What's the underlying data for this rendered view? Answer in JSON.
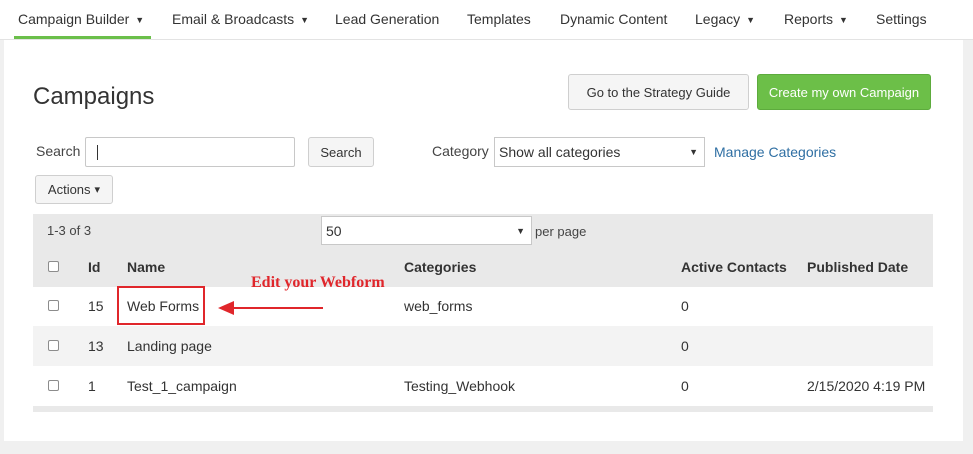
{
  "nav": {
    "items": [
      {
        "label": "Campaign Builder",
        "caret": true,
        "active": true
      },
      {
        "label": "Email & Broadcasts",
        "caret": true
      },
      {
        "label": "Lead Generation",
        "caret": false
      },
      {
        "label": "Templates",
        "caret": false
      },
      {
        "label": "Dynamic Content",
        "caret": false
      },
      {
        "label": "Legacy",
        "caret": true
      },
      {
        "label": "Reports",
        "caret": true
      },
      {
        "label": "Settings",
        "caret": false
      }
    ],
    "caret_glyph": "▼"
  },
  "page": {
    "title": "Campaigns",
    "strategy_button": "Go to the Strategy Guide",
    "create_button": "Create my own Campaign",
    "search_label": "Search",
    "search_value": "",
    "search_button": "Search",
    "category_label": "Category",
    "category_selected": "Show all categories",
    "manage_link": "Manage Categories",
    "actions_button": "Actions",
    "actions_caret": "▾",
    "select_arrow": "▼"
  },
  "pagination": {
    "range": "1-3 of 3",
    "per_page_value": "50",
    "per_page_label": "per page"
  },
  "table": {
    "headers": {
      "id": "Id",
      "name": "Name",
      "categories": "Categories",
      "active": "Active Contacts",
      "published": "Published Date"
    },
    "rows": [
      {
        "id": "15",
        "name": "Web Forms",
        "categories": "web_forms",
        "active": "0",
        "published": ""
      },
      {
        "id": "13",
        "name": "Landing page",
        "categories": "",
        "active": "0",
        "published": ""
      },
      {
        "id": "1",
        "name": "Test_1_campaign",
        "categories": "Testing_Webhook",
        "active": "0",
        "published": "2/15/2020 4:19 PM"
      }
    ]
  },
  "annotation": {
    "text": "Edit your Webform",
    "color": "#e0262b"
  },
  "colors": {
    "accent_green": "#6cbf48",
    "link_blue": "#2f6fa3"
  }
}
